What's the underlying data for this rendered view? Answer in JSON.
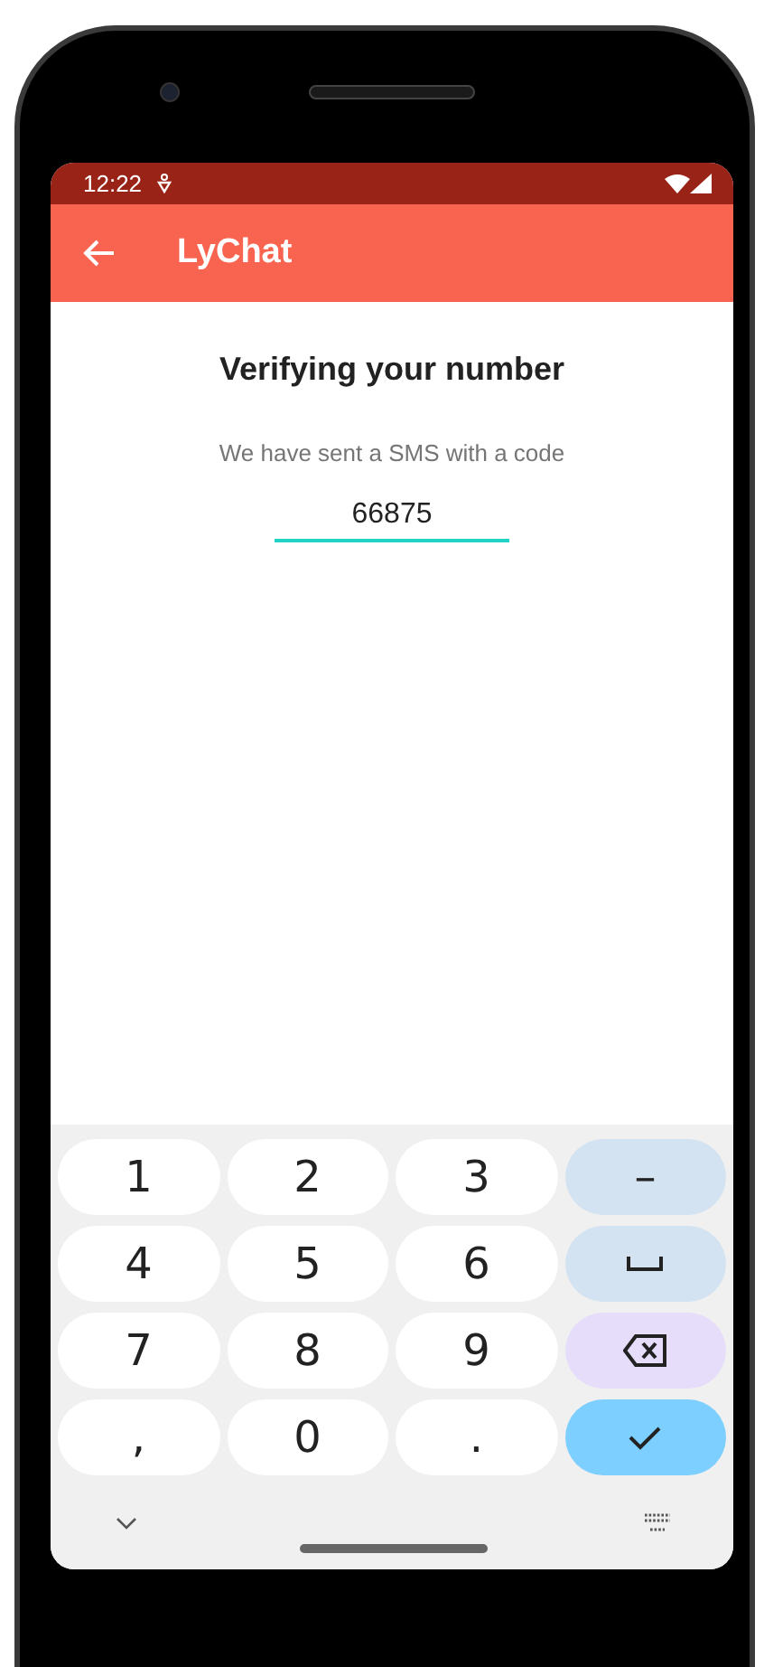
{
  "status_bar": {
    "time": "12:22"
  },
  "app_bar": {
    "title": "LyChat"
  },
  "verification": {
    "title": "Verifying your number",
    "message": "We have sent a SMS with a code",
    "code_field": {
      "value": "66875"
    }
  },
  "keyboard": {
    "keys": [
      {
        "kind": "digit",
        "label": "1"
      },
      {
        "kind": "digit",
        "label": "2"
      },
      {
        "kind": "digit",
        "label": "3"
      },
      {
        "kind": "symbol",
        "label": "–"
      },
      {
        "kind": "digit",
        "label": "4"
      },
      {
        "kind": "digit",
        "label": "5"
      },
      {
        "kind": "digit",
        "label": "6"
      },
      {
        "kind": "space"
      },
      {
        "kind": "digit",
        "label": "7"
      },
      {
        "kind": "digit",
        "label": "8"
      },
      {
        "kind": "digit",
        "label": "9"
      },
      {
        "kind": "backspace"
      },
      {
        "kind": "digit",
        "label": ","
      },
      {
        "kind": "digit",
        "label": "0"
      },
      {
        "kind": "digit",
        "label": "."
      },
      {
        "kind": "done"
      }
    ]
  }
}
